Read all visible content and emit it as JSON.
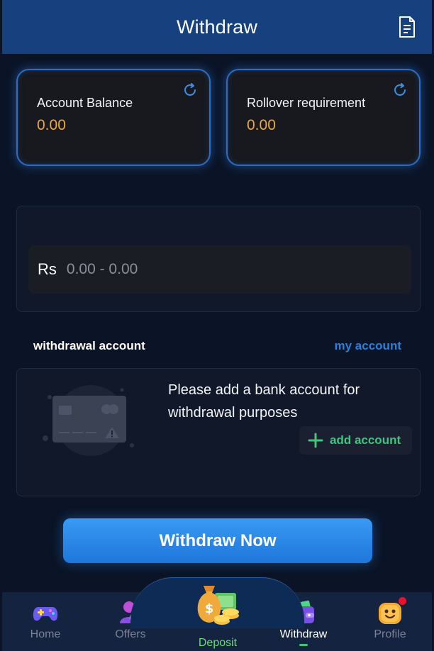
{
  "header": {
    "title": "Withdraw",
    "record_icon": "document-icon"
  },
  "balances": {
    "account": {
      "label": "Account Balance",
      "value": "0.00"
    },
    "rollover": {
      "label": "Rollover requirement",
      "value": "0.00"
    },
    "refresh_icon": "refresh-icon"
  },
  "amount": {
    "currency": "Rs",
    "range": "0.00 - 0.00"
  },
  "withdrawal_account": {
    "title": "withdrawal account",
    "link": "my account",
    "message": "Please add a bank account for withdrawal purposes",
    "add_label": "add account"
  },
  "withdraw_button": {
    "label": "Withdraw Now"
  },
  "bottom_nav": {
    "items": [
      {
        "label": "Home",
        "icon": "gamepad-icon"
      },
      {
        "label": "Offers",
        "icon": "offers-icon"
      },
      {
        "label": "Deposit",
        "icon": "money-bag-icon"
      },
      {
        "label": "Withdraw",
        "icon": "wallet-icon"
      },
      {
        "label": "Profile",
        "icon": "profile-face-icon"
      }
    ]
  },
  "colors": {
    "accent_blue": "#2e7fd6",
    "balance_value": "#f0a73a",
    "green": "#3ec77b",
    "badge_red": "#e8132a",
    "background": "#0b1426"
  }
}
